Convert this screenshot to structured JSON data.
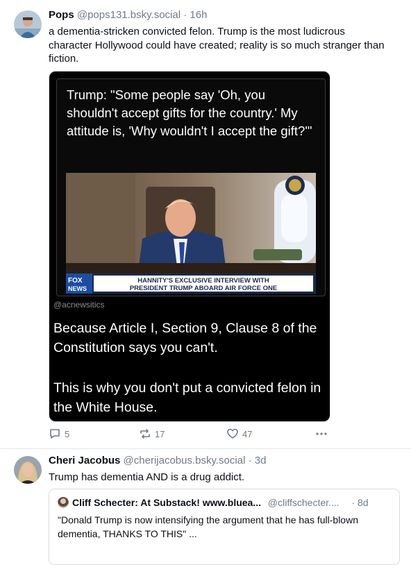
{
  "post1": {
    "author_name": "Pops",
    "author_handle": "@pops131.bsky.social",
    "separator": "·",
    "time": "16h",
    "text": "a dementia-stricken convicted felon. Trump is the most ludicrous character Hollywood could have created; reality is so much stranger than fiction.",
    "media": {
      "quote_text": "Trump: \"Some people say 'Oh, you shouldn't accept gifts for the country.' My attitude is, 'Why wouldn't I accept the gift?'\"",
      "chyron_line1": "HANNITY'S EXCLUSIVE INTERVIEW WITH",
      "chyron_line2": "PRESIDENT TRUMP ABOARD AIR FORCE ONE",
      "network_logo": "FOX NEWS",
      "credit": "@acnewsitics",
      "paragraph1": "Because Article I, Section 9, Clause 8 of the Constitution says you can't.",
      "paragraph2": "This is why you don't put a convicted felon in the White House."
    },
    "actions": {
      "replies": "5",
      "reposts": "17",
      "likes": "47",
      "more_icon": "more-dots-icon"
    }
  },
  "post2": {
    "author_name": "Cheri Jacobus",
    "author_handle": "@cherijacobus.bsky.social",
    "separator": "·",
    "time": "3d",
    "text": "Trump has dementia AND is a drug addict.",
    "embed": {
      "author_name": "Cliff Schecter: At Substack! www.bluea...",
      "author_handle": "@cliffschecter....",
      "separator": "·",
      "time": "8d",
      "text": "\"Donald Trump is now intensifying the argument that he has full-blown dementia, THANKS TO THIS\" ..."
    }
  },
  "colors": {
    "name": "#0b0f14",
    "muted": "#6f7b88",
    "divider": "#e4e8ec",
    "media_bg": "#000000"
  }
}
